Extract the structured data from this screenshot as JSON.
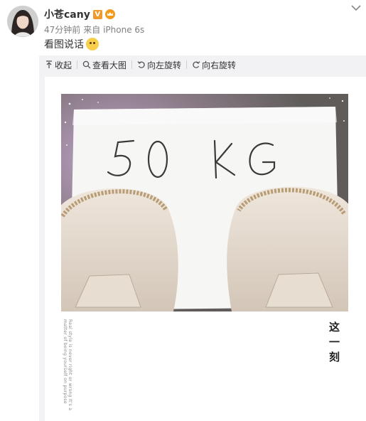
{
  "post": {
    "username": "小苍cany",
    "time": "47分钟前",
    "source": "来自 iPhone 6s",
    "text": "看图说话",
    "emoji_icon": "happy-face-icon",
    "verified_badge": "V"
  },
  "toolbar": {
    "collapse": "收起",
    "view_large": "查看大图",
    "rotate_left": "向左旋转",
    "rotate_right": "向右旋转"
  },
  "image": {
    "handwritten_text": "50 KG",
    "caption_en": "Real style is never right or wrong It's a matter of being yourself on purpose",
    "caption_cn": "这一刻"
  },
  "colors": {
    "badge_orange": "#f09a2b",
    "toolbar_bg": "#f2f2f5",
    "meta_gray": "#808080"
  }
}
